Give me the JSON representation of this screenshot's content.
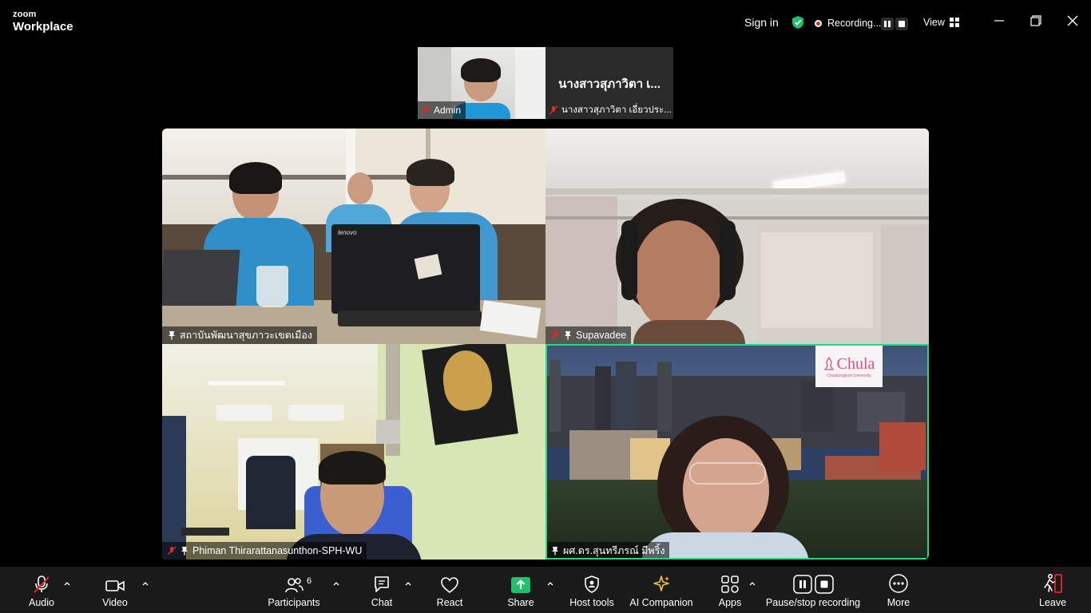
{
  "app": {
    "logo_top": "zoom",
    "logo_bottom": "Workplace"
  },
  "titlebar": {
    "sign_in": "Sign in",
    "recording_label": "Recording...",
    "view_label": "View"
  },
  "thumbnails": [
    {
      "name": "Admin",
      "muted": true
    },
    {
      "display_name": "นางสาวสุภาวิตา เ...",
      "name": "นางสาวสุภาวิตา เอี่ยวประ...",
      "muted": true
    }
  ],
  "tiles": [
    {
      "name": "สถาบันพัฒนาสุขภาวะเขตเมือง",
      "muted": false,
      "pinned": true,
      "laptop_brand": "lenovo"
    },
    {
      "name": "Supavadee",
      "muted": true,
      "pinned": true
    },
    {
      "name": "Phiman Thirarattanasunthon-SPH-WU",
      "muted": true,
      "pinned": true
    },
    {
      "name": "ผศ.ดร.สุนทรีภรณ์ มีพริ้ง",
      "muted": false,
      "pinned": true,
      "active_speaker": true,
      "background_logo": "Chula",
      "background_logo_sub": "Chulalongkorn University"
    }
  ],
  "toolbar": {
    "audio": "Audio",
    "video": "Video",
    "participants": "Participants",
    "participants_count": "6",
    "chat": "Chat",
    "react": "React",
    "share": "Share",
    "host_tools": "Host tools",
    "ai_companion": "AI Companion",
    "apps": "Apps",
    "pause_stop_recording": "Pause/stop recording",
    "more": "More",
    "leave": "Leave"
  },
  "colors": {
    "active_speaker_border": "#2dd67a",
    "share_green": "#1fc26b",
    "record_red": "#e02828",
    "leave_red": "#e02828"
  }
}
